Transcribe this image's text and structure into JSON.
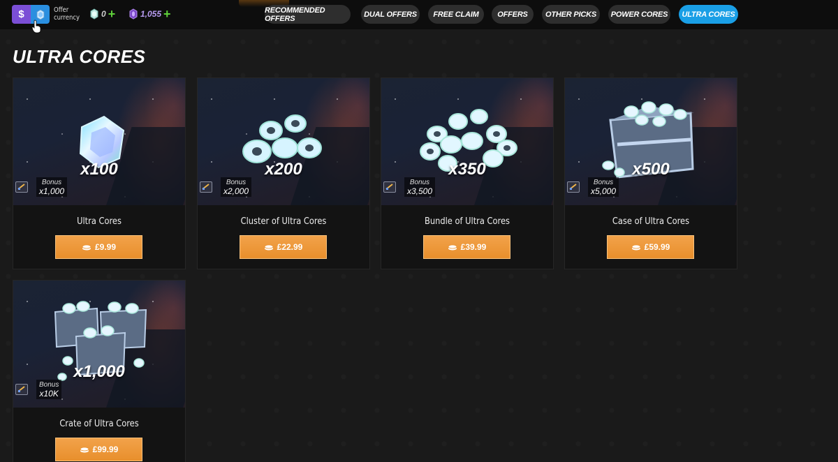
{
  "topbar": {
    "currency_toggle": {
      "dollar_label": "$"
    },
    "offer_currency_label_line1": "Offer",
    "offer_currency_label_line2": "currency",
    "currencies": [
      {
        "icon": "ultra-core-icon",
        "value": "0"
      },
      {
        "icon": "purple-gem-icon",
        "value": "1,055"
      }
    ],
    "tabs": [
      {
        "label": "Recommended Offers",
        "active": false
      },
      {
        "label": "Dual Offers",
        "active": false
      },
      {
        "label": "Free Claim",
        "active": false
      },
      {
        "label": "Offers",
        "active": false
      },
      {
        "label": "Other Picks",
        "active": false
      },
      {
        "label": "Power Cores",
        "active": false
      },
      {
        "label": "Ultra Cores",
        "active": true
      }
    ]
  },
  "main": {
    "section_title": "Ultra Cores",
    "cards": [
      {
        "name": "Ultra Cores",
        "quantity": "x100",
        "bonus_label": "Bonus",
        "bonus_value": "x1,000",
        "price": "£9.99"
      },
      {
        "name": "Cluster of Ultra Cores",
        "quantity": "x200",
        "bonus_label": "Bonus",
        "bonus_value": "x2,000",
        "price": "£22.99"
      },
      {
        "name": "Bundle of Ultra Cores",
        "quantity": "x350",
        "bonus_label": "Bonus",
        "bonus_value": "x3,500",
        "price": "£39.99"
      },
      {
        "name": "Case of Ultra Cores",
        "quantity": "x500",
        "bonus_label": "Bonus",
        "bonus_value": "x5,000",
        "price": "£59.99"
      },
      {
        "name": "Crate of Ultra Cores",
        "quantity": "x1,000",
        "bonus_label": "Bonus",
        "bonus_value": "x10K",
        "price": "£99.99"
      }
    ]
  },
  "colors": {
    "accent_blue": "#1a9fe6",
    "button_orange": "#f2a24a",
    "toggle_purple": "#7b4fd6",
    "plus_green": "#5fd03a"
  }
}
